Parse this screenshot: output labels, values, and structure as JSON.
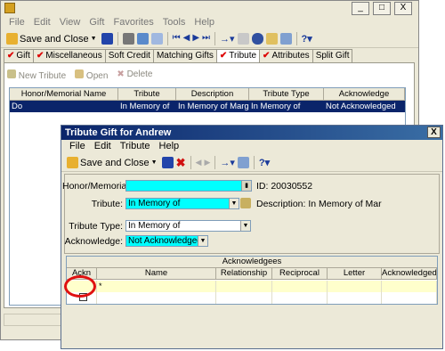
{
  "main": {
    "menu": [
      "File",
      "Edit",
      "View",
      "Gift",
      "Favorites",
      "Tools",
      "Help"
    ],
    "toolbar": {
      "save_close": "Save and Close"
    },
    "tabs": [
      {
        "label": "Gift",
        "checked": true
      },
      {
        "label": "Miscellaneous",
        "checked": true
      },
      {
        "label": "Soft Credit",
        "checked": false
      },
      {
        "label": "Matching Gifts",
        "checked": false
      },
      {
        "label": "Tribute",
        "checked": true,
        "active": true
      },
      {
        "label": "Attributes",
        "checked": true
      },
      {
        "label": "Split Gift",
        "checked": false
      }
    ],
    "subtoolbar": {
      "new": "New Tribute",
      "open": "Open",
      "delete": "Delete"
    },
    "grid": {
      "columns": [
        "Honor/Memorial Name",
        "Tribute",
        "Description",
        "Tribute Type",
        "Acknowledge"
      ],
      "rows": [
        [
          "Do",
          "In Memory of",
          "In Memory of Marg...",
          "In Memory of",
          "Not Acknowledged"
        ]
      ]
    },
    "window_buttons": {
      "min": "_",
      "max": "□",
      "close": "X"
    }
  },
  "dialog": {
    "title": "Tribute Gift for Andrew",
    "close": "X",
    "menu": [
      "File",
      "Edit",
      "Tribute",
      "Help"
    ],
    "toolbar": {
      "save_close": "Save and Close"
    },
    "fields": {
      "honor_label": "Honor/Memorial:",
      "honor_value": "",
      "id_text": "ID:  20030552",
      "tribute_label": "Tribute:",
      "tribute_value": "In Memory of",
      "description_text": "Description: In Memory of Mar",
      "type_label": "Tribute Type:",
      "type_value": "In Memory of",
      "ack_label": "Acknowledge:",
      "ack_value": "Not Acknowledged"
    },
    "ack_grid": {
      "title": "Acknowledgees",
      "columns": [
        "Ackn",
        "Name",
        "Relationship",
        "Reciprocal",
        "Letter",
        "Acknowledged..."
      ],
      "new_row_marker": "*"
    }
  },
  "colors": {
    "highlight": "#00ffff",
    "selection": "#0a246a",
    "row_new": "#ffffcc",
    "annotation": "#e01010"
  }
}
